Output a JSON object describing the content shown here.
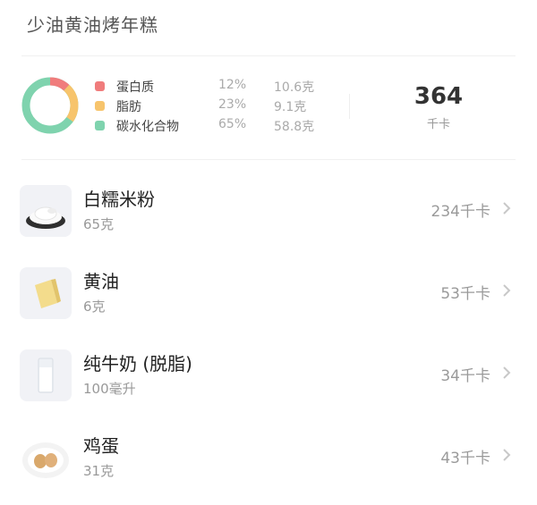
{
  "header": {
    "title": "少油黄油烤年糕"
  },
  "summary": {
    "macros": [
      {
        "name": "蛋白质",
        "percent": "12%",
        "amount": "10.6克",
        "color": "#f07c7c"
      },
      {
        "name": "脂肪",
        "percent": "23%",
        "amount": "9.1克",
        "color": "#f7c46c"
      },
      {
        "name": "碳水化合物",
        "percent": "65%",
        "amount": "58.8克",
        "color": "#7fd3ae"
      }
    ],
    "calories": "364",
    "calories_unit": "千卡"
  },
  "ingredients": [
    {
      "name": "白糯米粉",
      "quantity": "65克",
      "calories": "234千卡",
      "icon": "rice-flour-icon"
    },
    {
      "name": "黄油",
      "quantity": "6克",
      "calories": "53千卡",
      "icon": "butter-icon"
    },
    {
      "name": "纯牛奶 (脱脂)",
      "quantity": "100毫升",
      "calories": "34千卡",
      "icon": "milk-glass-icon"
    },
    {
      "name": "鸡蛋",
      "quantity": "31克",
      "calories": "43千卡",
      "icon": "eggs-icon"
    }
  ]
}
